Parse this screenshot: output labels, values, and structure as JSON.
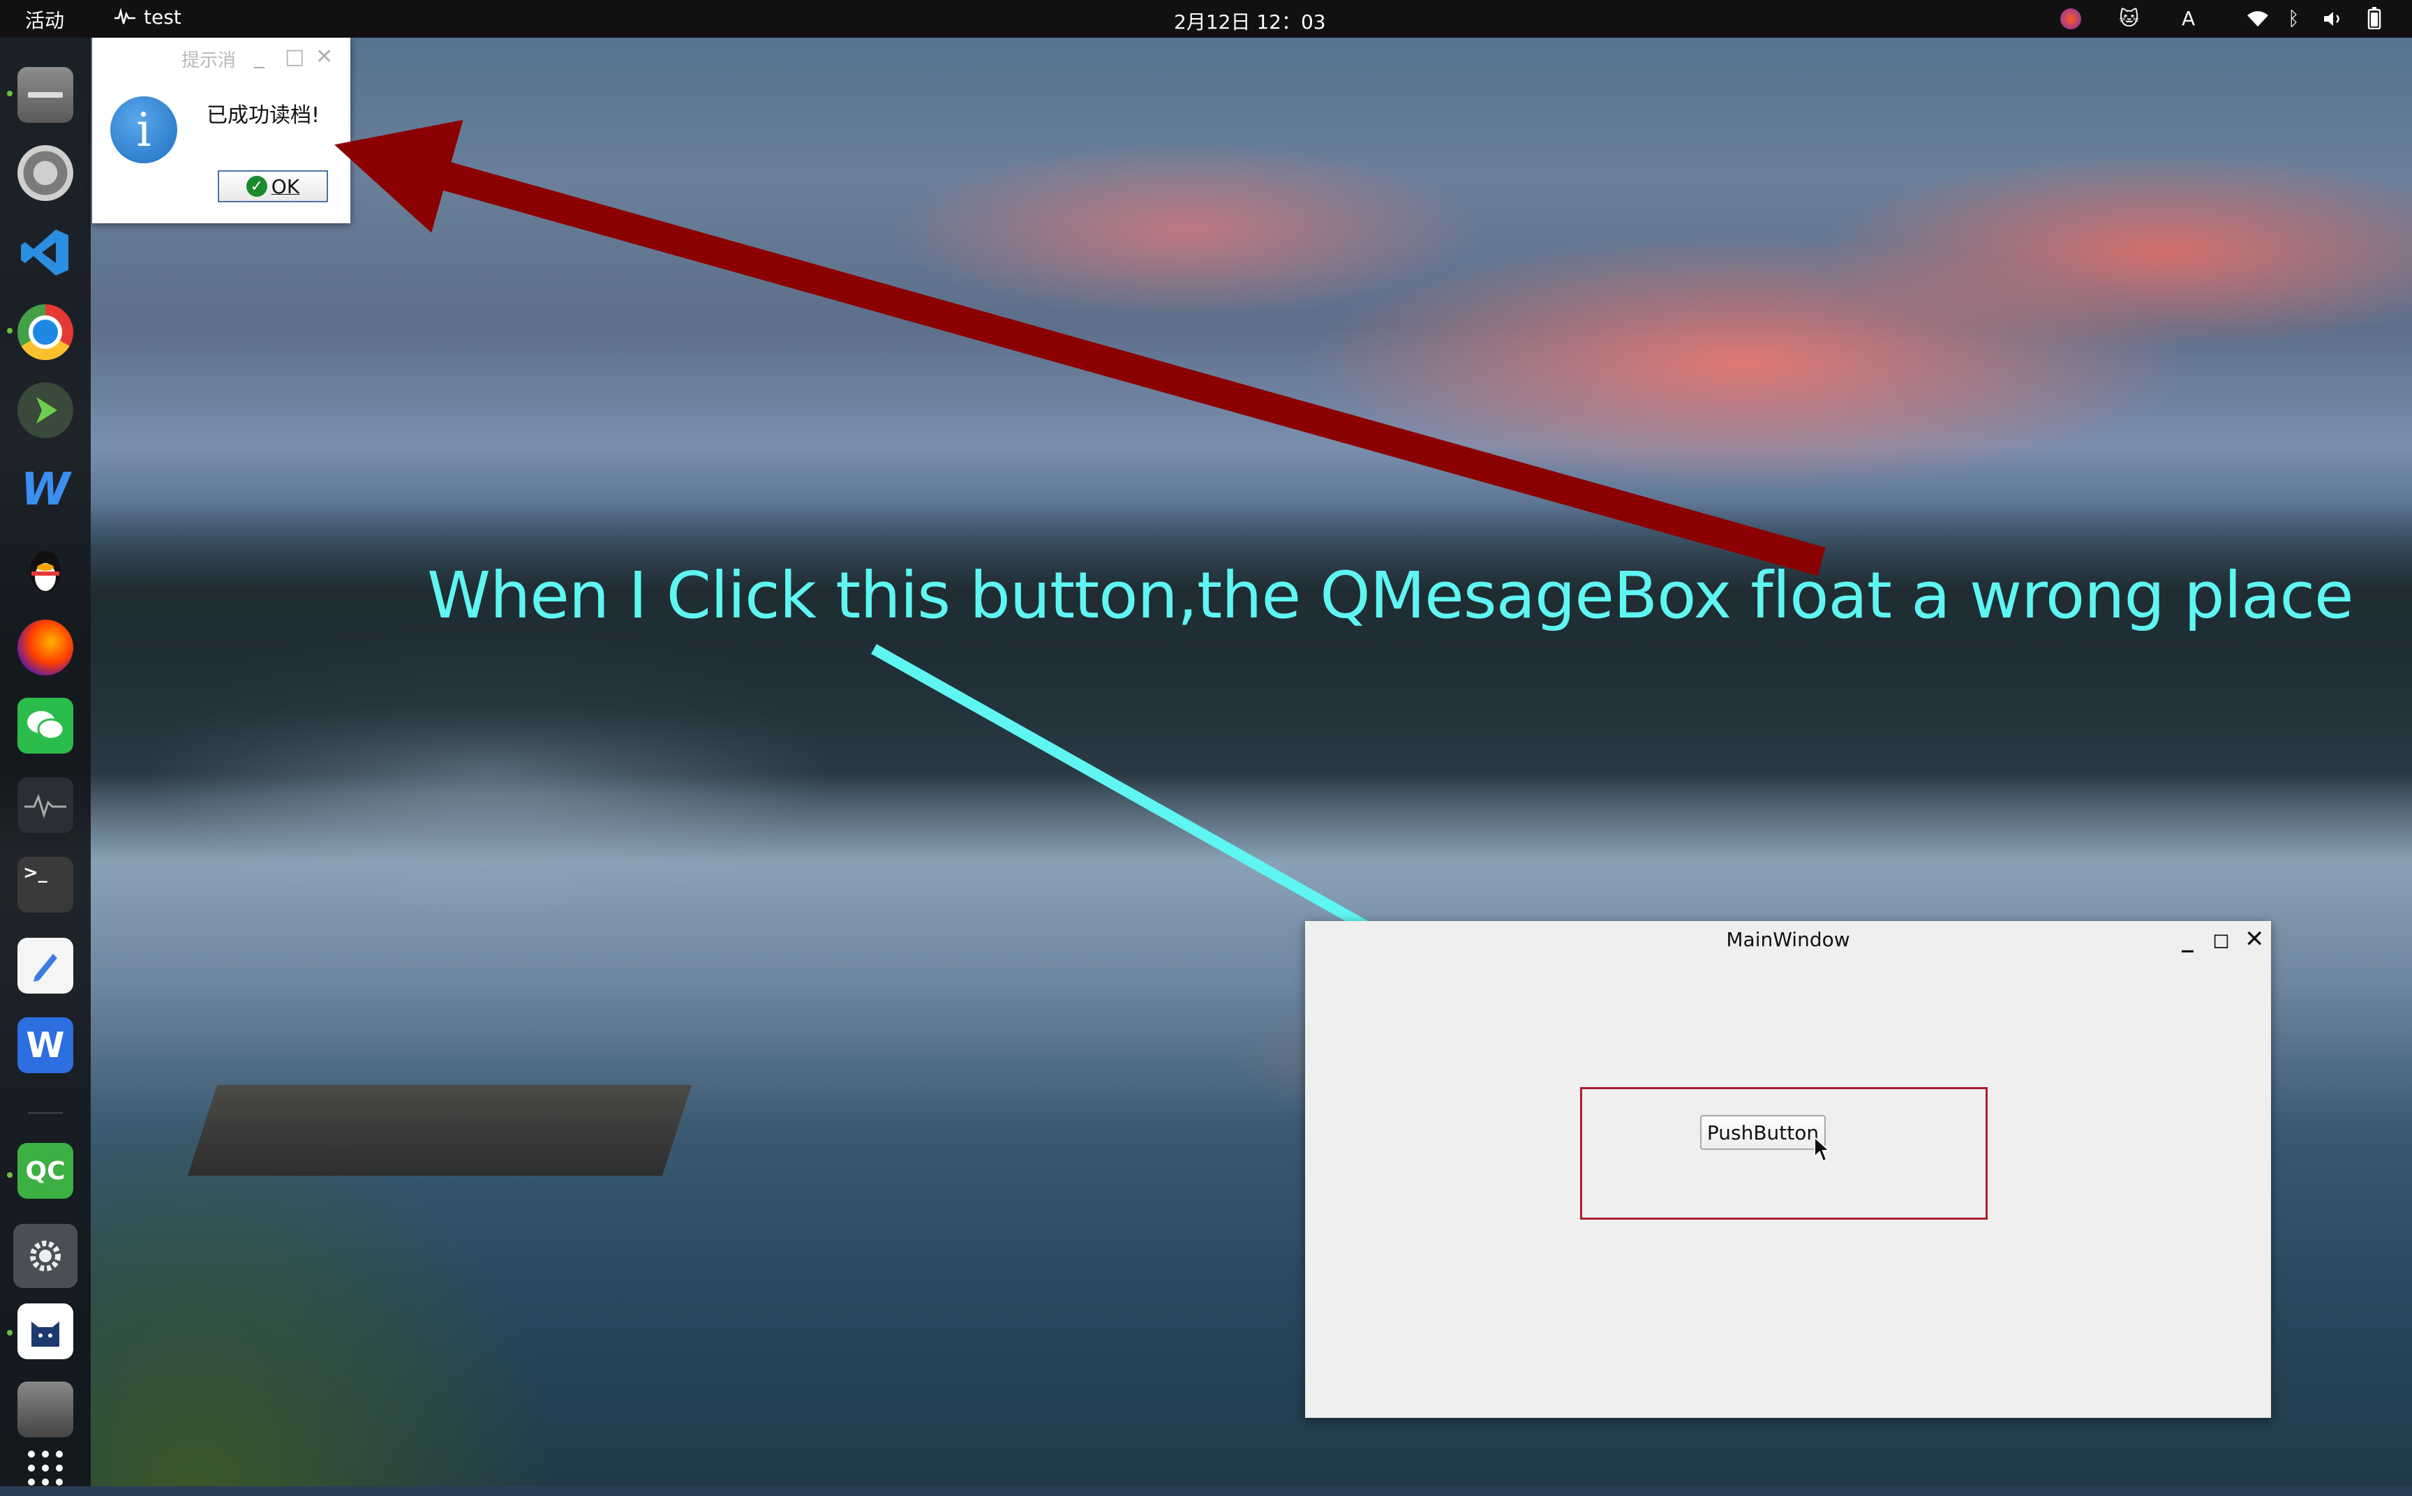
{
  "topbar": {
    "activities": "活动",
    "app_name": "test",
    "clock": "2月12日  12：03",
    "input_method": "A"
  },
  "msgbox": {
    "title": "提示消",
    "text": "已成功读档!",
    "ok_label": "OK",
    "icon": "i"
  },
  "annotation": {
    "text": "When I Click this button,the QMesageBox float a wrong place"
  },
  "mainwindow": {
    "title": "MainWindow",
    "pushbutton_label": "PushButton"
  },
  "dock": {
    "items": [
      {
        "name": "files-icon",
        "running": true
      },
      {
        "name": "settings-gear-icon",
        "running": false
      },
      {
        "name": "vscode-icon",
        "running": false
      },
      {
        "name": "chrome-icon",
        "running": true
      },
      {
        "name": "arrow-play-icon",
        "running": false
      },
      {
        "name": "wps-writer-icon",
        "running": false
      },
      {
        "name": "qq-penguin-icon",
        "running": false
      },
      {
        "name": "firefox-dev-icon",
        "running": false
      },
      {
        "name": "wechat-icon",
        "running": false
      },
      {
        "name": "system-monitor-icon",
        "running": false
      },
      {
        "name": "terminal-icon",
        "running": false
      },
      {
        "name": "text-editor-icon",
        "running": false
      },
      {
        "name": "wps-office-icon",
        "running": false
      },
      {
        "name": "qt-creator-icon",
        "running": true
      },
      {
        "name": "settings-app-icon",
        "running": true
      },
      {
        "name": "cat-app-icon",
        "running": true
      },
      {
        "name": "drive-icon",
        "running": false
      },
      {
        "name": "app-grid-icon",
        "running": false
      }
    ]
  },
  "colors": {
    "annotation": "#5ef5f2",
    "red_arrow": "#8b0000",
    "cyan_arrow": "#5ef5f2",
    "highlight_border": "#a81e2e",
    "topbar": "#111111"
  }
}
